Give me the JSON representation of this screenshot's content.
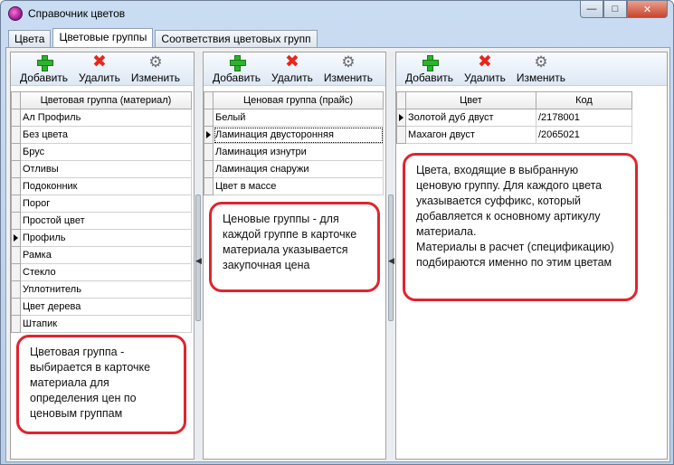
{
  "window": {
    "title": "Справочник цветов"
  },
  "tabs": [
    {
      "label": "Цвета"
    },
    {
      "label": "Цветовые группы"
    },
    {
      "label": "Соответствия цветовых групп"
    }
  ],
  "toolbar": {
    "add": "Добавить",
    "delete": "Удалить",
    "edit": "Изменить"
  },
  "color_groups": {
    "header": "Цветовая группа (материал)",
    "rows": [
      "Ал Профиль",
      "Без цвета",
      "Брус",
      "Отливы",
      "Подоконник",
      "Порог",
      "Простой цвет",
      "Профиль",
      "Рамка",
      "Стекло",
      "Уплотнитель",
      "Цвет дерева",
      "Штапик"
    ],
    "current_row": "Профиль"
  },
  "price_groups": {
    "header": "Ценовая группа (прайс)",
    "rows": [
      "Белый",
      "Ламинация двусторонняя",
      "Ламинация изнутри",
      "Ламинация снаружи",
      "Цвет в массе"
    ],
    "current_row": "Ламинация двусторонняя"
  },
  "colors": {
    "headers": [
      "Цвет",
      "Код"
    ],
    "rows": [
      {
        "name": "Золотой дуб двуст",
        "code": "/2178001"
      },
      {
        "name": "Махагон двуст",
        "code": "/2065021"
      }
    ]
  },
  "callouts": {
    "left": "Цветовая группа - выбирается в карточке материала для определения цен по ценовым группам",
    "middle": "Ценовые группы - для каждой группе в карточке материала указывается закупочная цена",
    "right": "Цвета, входящие в выбранную ценовую группу. Для каждого цвета указывается суффикс, который добавляется к основному артикулу материала.\nМатериалы в расчет (спецификацию) подбираются именно по этим цветам"
  },
  "colors_theme": {
    "accent": "#e1242f"
  }
}
